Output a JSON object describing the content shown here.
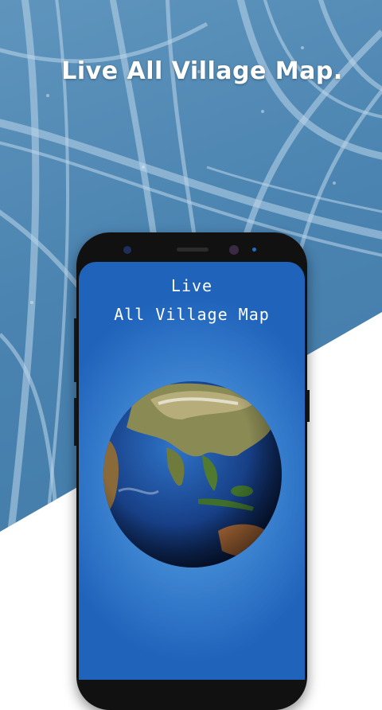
{
  "promo": {
    "headline": "Live All Village Map."
  },
  "app_screen": {
    "title_line1": "Live",
    "title_line2": "All Village Map"
  },
  "icons": {
    "globe": "earth-globe-icon",
    "camera": "front-camera-icon",
    "speaker": "earpiece-speaker-icon"
  },
  "colors": {
    "background_blue": "#4a83b0",
    "screen_blue": "#1f63bb",
    "headline_text": "#ffffff"
  }
}
